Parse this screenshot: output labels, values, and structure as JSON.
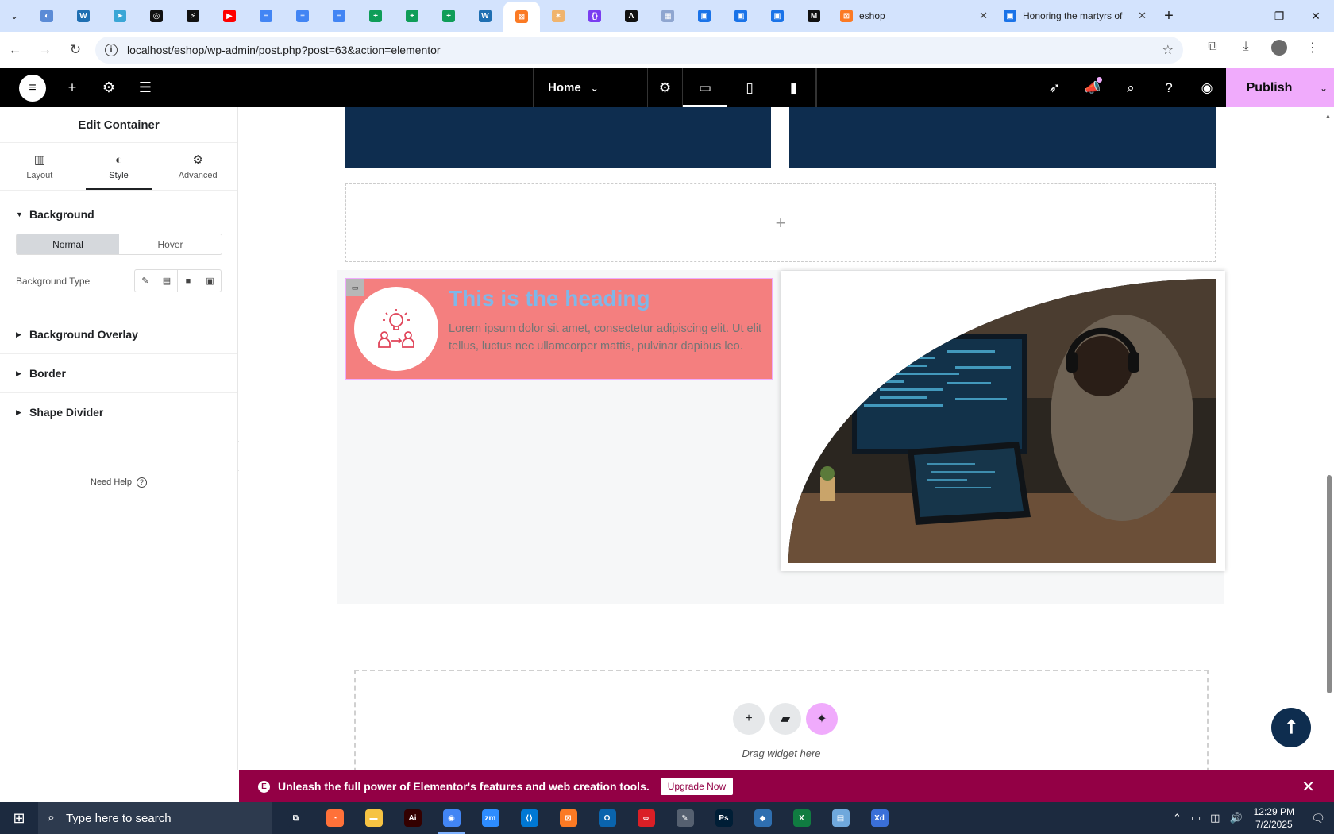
{
  "browser": {
    "pinned_tabs": [
      {
        "icon": "globe-icon",
        "color": "#5b8bd6"
      },
      {
        "icon": "wordpress-icon",
        "color": "#1f6fb2"
      },
      {
        "icon": "arrow-icon",
        "color": "#3aa6d6"
      },
      {
        "icon": "openai-icon",
        "color": "#111111"
      },
      {
        "icon": "bolt-icon",
        "color": "#111111"
      },
      {
        "icon": "youtube-icon",
        "color": "#ff0000"
      },
      {
        "icon": "docs-icon",
        "color": "#4285f4"
      },
      {
        "icon": "docs-icon",
        "color": "#4285f4"
      },
      {
        "icon": "docs-icon",
        "color": "#4285f4"
      },
      {
        "icon": "sheets-icon",
        "color": "#0f9d58"
      },
      {
        "icon": "sheets-icon",
        "color": "#0f9d58"
      },
      {
        "icon": "sheets-icon",
        "color": "#0f9d58"
      },
      {
        "icon": "wp-blue-icon",
        "color": "#1f6fb2"
      },
      {
        "icon": "xampp-icon",
        "color": "#fb7a24",
        "active": true
      },
      {
        "icon": "claude-icon",
        "color": "#f0b46e"
      },
      {
        "icon": "code-icon",
        "color": "#7a3df0"
      },
      {
        "icon": "vercel-icon",
        "color": "#111111"
      },
      {
        "icon": "grid-icon",
        "color": "#8fa6d0"
      },
      {
        "icon": "forms-icon",
        "color": "#1a73e8"
      },
      {
        "icon": "forms-icon",
        "color": "#1a73e8"
      },
      {
        "icon": "forms-icon",
        "color": "#1a73e8"
      },
      {
        "icon": "medium-icon",
        "color": "#111111"
      }
    ],
    "tabs": [
      {
        "title": "eshop",
        "icon": "xampp-icon",
        "color": "#fb7a24"
      },
      {
        "title": "Honoring the martyrs of",
        "icon": "forms-icon",
        "color": "#1a73e8"
      }
    ],
    "url": "localhost/eshop/wp-admin/post.php?post=63&action=elementor"
  },
  "editor": {
    "page_name": "Home",
    "publish_label": "Publish"
  },
  "panel": {
    "title": "Edit Container",
    "tabs": [
      {
        "label": "Layout",
        "icon": "layout-icon"
      },
      {
        "label": "Style",
        "icon": "style-icon",
        "active": true
      },
      {
        "label": "Advanced",
        "icon": "gear-icon"
      }
    ],
    "sections": {
      "background": "Background",
      "normal": "Normal",
      "hover": "Hover",
      "background_type": "Background Type",
      "background_overlay": "Background Overlay",
      "border": "Border",
      "shape_divider": "Shape Divider"
    },
    "need_help": "Need Help"
  },
  "canvas": {
    "heading": "This is the heading",
    "body": "Lorem ipsum dolor sit amet, consectetur adipiscing elit. Ut elit tellus, luctus nec ullamcorper mattis, pulvinar dapibus leo.",
    "drag_label": "Drag widget here"
  },
  "promo": {
    "text": "Unleash the full power of Elementor's features and web creation tools.",
    "button": "Upgrade Now"
  },
  "taskbar": {
    "search_placeholder": "Type here to search",
    "time": "12:29 PM",
    "date": "7/2/2025",
    "apps": [
      {
        "icon": "task-view-icon",
        "color": "#1c2a3f"
      },
      {
        "icon": "firefox-icon",
        "color": "#ff7139"
      },
      {
        "icon": "file-explorer-icon",
        "color": "#f6c343"
      },
      {
        "icon": "illustrator-icon",
        "color": "#330000"
      },
      {
        "icon": "chrome-icon",
        "color": "#4285f4",
        "active": true
      },
      {
        "icon": "zoom-icon",
        "color": "#2d8cff"
      },
      {
        "icon": "vscode-icon",
        "color": "#0078d4"
      },
      {
        "icon": "xampp-icon",
        "color": "#fb7a24"
      },
      {
        "icon": "outlook-icon",
        "color": "#0a64ad"
      },
      {
        "icon": "creative-cloud-icon",
        "color": "#da1f26"
      },
      {
        "icon": "pen-icon",
        "color": "#556070"
      },
      {
        "icon": "photoshop-icon",
        "color": "#001e36"
      },
      {
        "icon": "app-icon",
        "color": "#2f6fb0"
      },
      {
        "icon": "excel-icon",
        "color": "#107c41"
      },
      {
        "icon": "notes-icon",
        "color": "#6fa8dc"
      },
      {
        "icon": "xd-icon",
        "color": "#3a6fd8"
      }
    ]
  }
}
